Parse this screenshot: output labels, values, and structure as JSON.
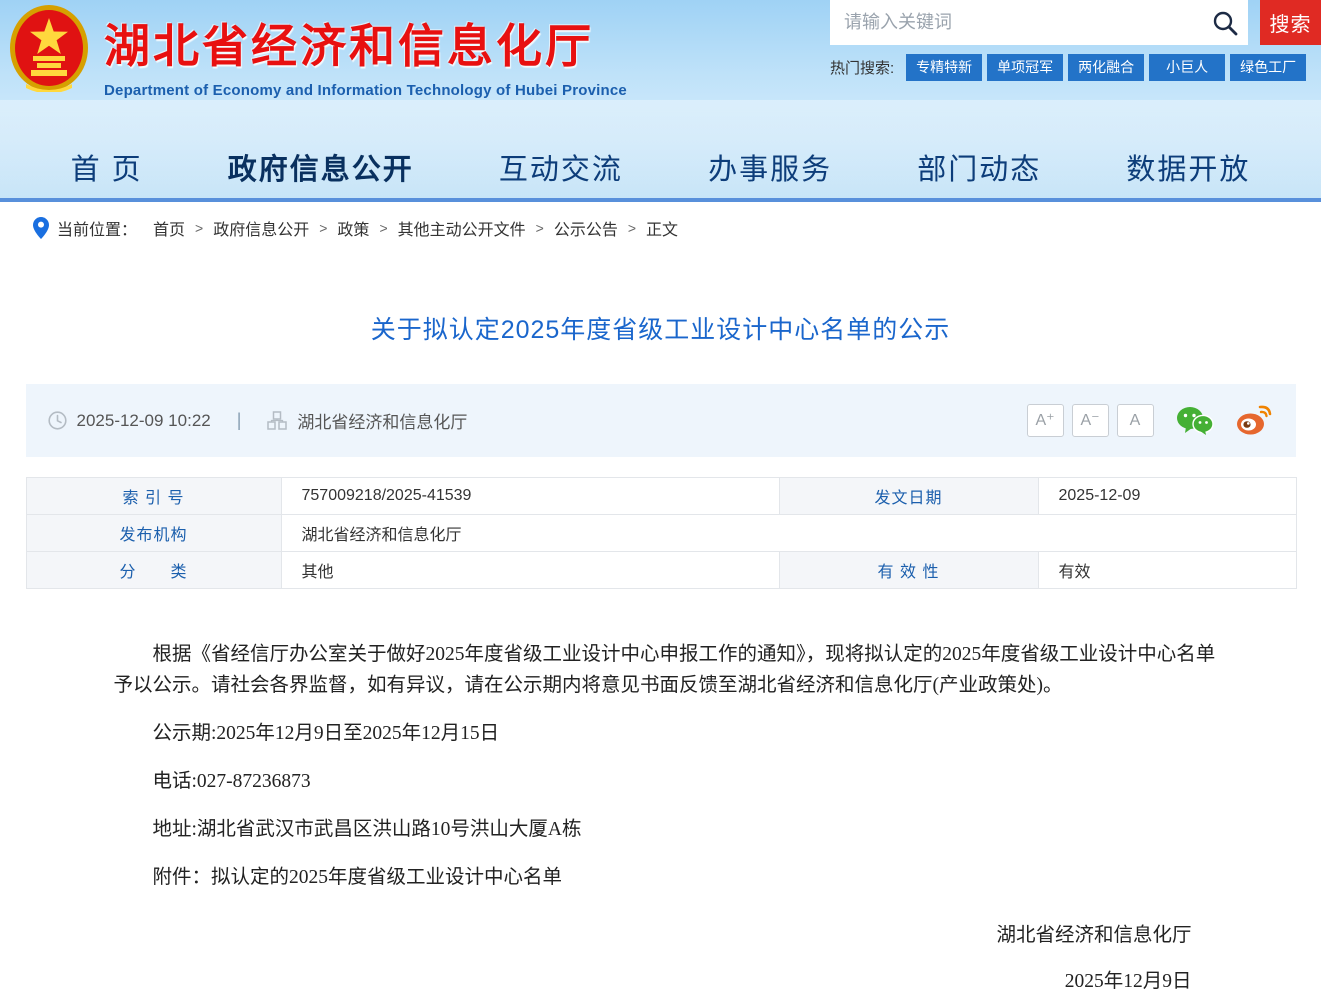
{
  "header": {
    "site_title": "湖北省经济和信息化厅",
    "site_subtitle": "Department of Economy and Information Technology of Hubei Province",
    "search": {
      "placeholder": "请输入关键词",
      "button_label": "搜索",
      "hot_label": "热门搜索:",
      "hot_tags": [
        "专精特新",
        "单项冠军",
        "两化融合",
        "小巨人",
        "绿色工厂"
      ]
    }
  },
  "nav": {
    "items": [
      {
        "label": "首 页"
      },
      {
        "label": "政府信息公开"
      },
      {
        "label": "互动交流"
      },
      {
        "label": "办事服务"
      },
      {
        "label": "部门动态"
      },
      {
        "label": "数据开放"
      }
    ]
  },
  "breadcrumb": {
    "label": "当前位置：",
    "separator": ">",
    "items": [
      "首页",
      "政府信息公开",
      "政策",
      "其他主动公开文件",
      "公示公告",
      "正文"
    ]
  },
  "article": {
    "title": "关于拟认定2025年度省级工业设计中心名单的公示",
    "meta": {
      "datetime": "2025-12-09 10:22",
      "divider": "|",
      "source": "湖北省经济和信息化厅",
      "font_larger": "A⁺",
      "font_smaller": "A⁻",
      "font_normal": "A"
    },
    "info_table": {
      "rows": [
        {
          "cells": [
            {
              "label": "索 引 号",
              "value": "757009218/2025-41539"
            },
            {
              "label": "发文日期",
              "value": "2025-12-09"
            }
          ]
        },
        {
          "cells": [
            {
              "label": "发布机构",
              "value": "湖北省经济和信息化厅"
            }
          ]
        },
        {
          "cells": [
            {
              "label": "分　　类",
              "value": "其他"
            },
            {
              "label": "有 效 性",
              "value": "有效"
            }
          ]
        }
      ]
    },
    "paragraphs": [
      {
        "text": "根据《省经信厅办公室关于做好2025年度省级工业设计中心申报工作的通知》，现将拟认定的2025年度省级工业设计中心名单予以公示。请社会各界监督，如有异议，请在公示期内将意见书面反馈至湖北省经济和信息化厅(产业政策处)。"
      },
      {
        "text": "公示期:2025年12月9日至2025年12月15日"
      },
      {
        "text": "电话:027-87236873"
      },
      {
        "text": "地址:湖北省武汉市武昌区洪山路10号洪山大厦A栋"
      },
      {
        "text": "附件：拟认定的2025年度省级工业设计中心名单"
      }
    ],
    "signature": {
      "org": "湖北省经济和信息化厅",
      "date": "2025年12月9日"
    }
  },
  "colors": {
    "accent_blue": "#1356c8",
    "title_red": "#e81010",
    "search_button_red": "#e02a23",
    "tag_blue": "#2373c8",
    "link_blue": "#1a66cc",
    "table_label_blue": "#1b5fad",
    "meta_bg": "#eef5fc",
    "wechat_green": "#45b035",
    "weibo_orange": "#e6672e"
  }
}
